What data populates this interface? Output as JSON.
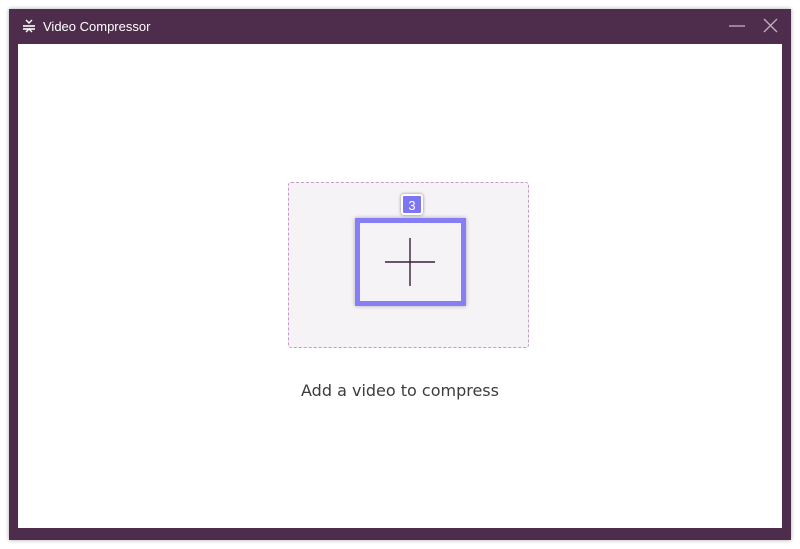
{
  "window": {
    "title": "Video Compressor",
    "icon": "compress-icon",
    "controls": [
      "minimize-icon",
      "close-icon"
    ]
  },
  "colors": {
    "titlebar": "#4e2d4c",
    "dropzone_border": "#c69bc8",
    "dropzone_bg": "#f6f3f7",
    "highlight": "#857ef6"
  },
  "main": {
    "step_badge": "3",
    "add_icon": "plus-icon",
    "hint": "Add a video to compress"
  }
}
